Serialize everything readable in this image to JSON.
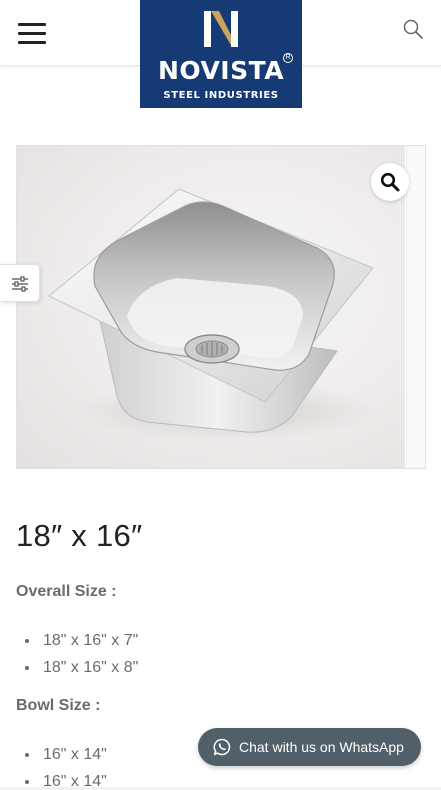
{
  "brand": {
    "name": "NOVISTA",
    "tagline": "STEEL INDUSTRIES",
    "registered_mark": "R",
    "bg_color": "#163a74",
    "accent_color": "#c9a45c"
  },
  "header": {
    "menu_icon": "hamburger-menu-icon",
    "search_icon": "search-icon"
  },
  "gallery": {
    "zoom_icon": "magnifier-icon",
    "filter_icon": "sliders-icon"
  },
  "product": {
    "title": "18″ x 16″",
    "overall_size_heading": "Overall Size :",
    "overall_sizes": [
      "18\" x 16\" x 7\"",
      "18\" x 16\" x 8\""
    ],
    "bowl_size_heading": "Bowl Size :",
    "bowl_sizes": [
      "16\" x 14\"",
      "16\" x 14\""
    ]
  },
  "whatsapp": {
    "label": "Chat with us on WhatsApp",
    "icon": "whatsapp-icon",
    "bg_color": "#515f68"
  }
}
